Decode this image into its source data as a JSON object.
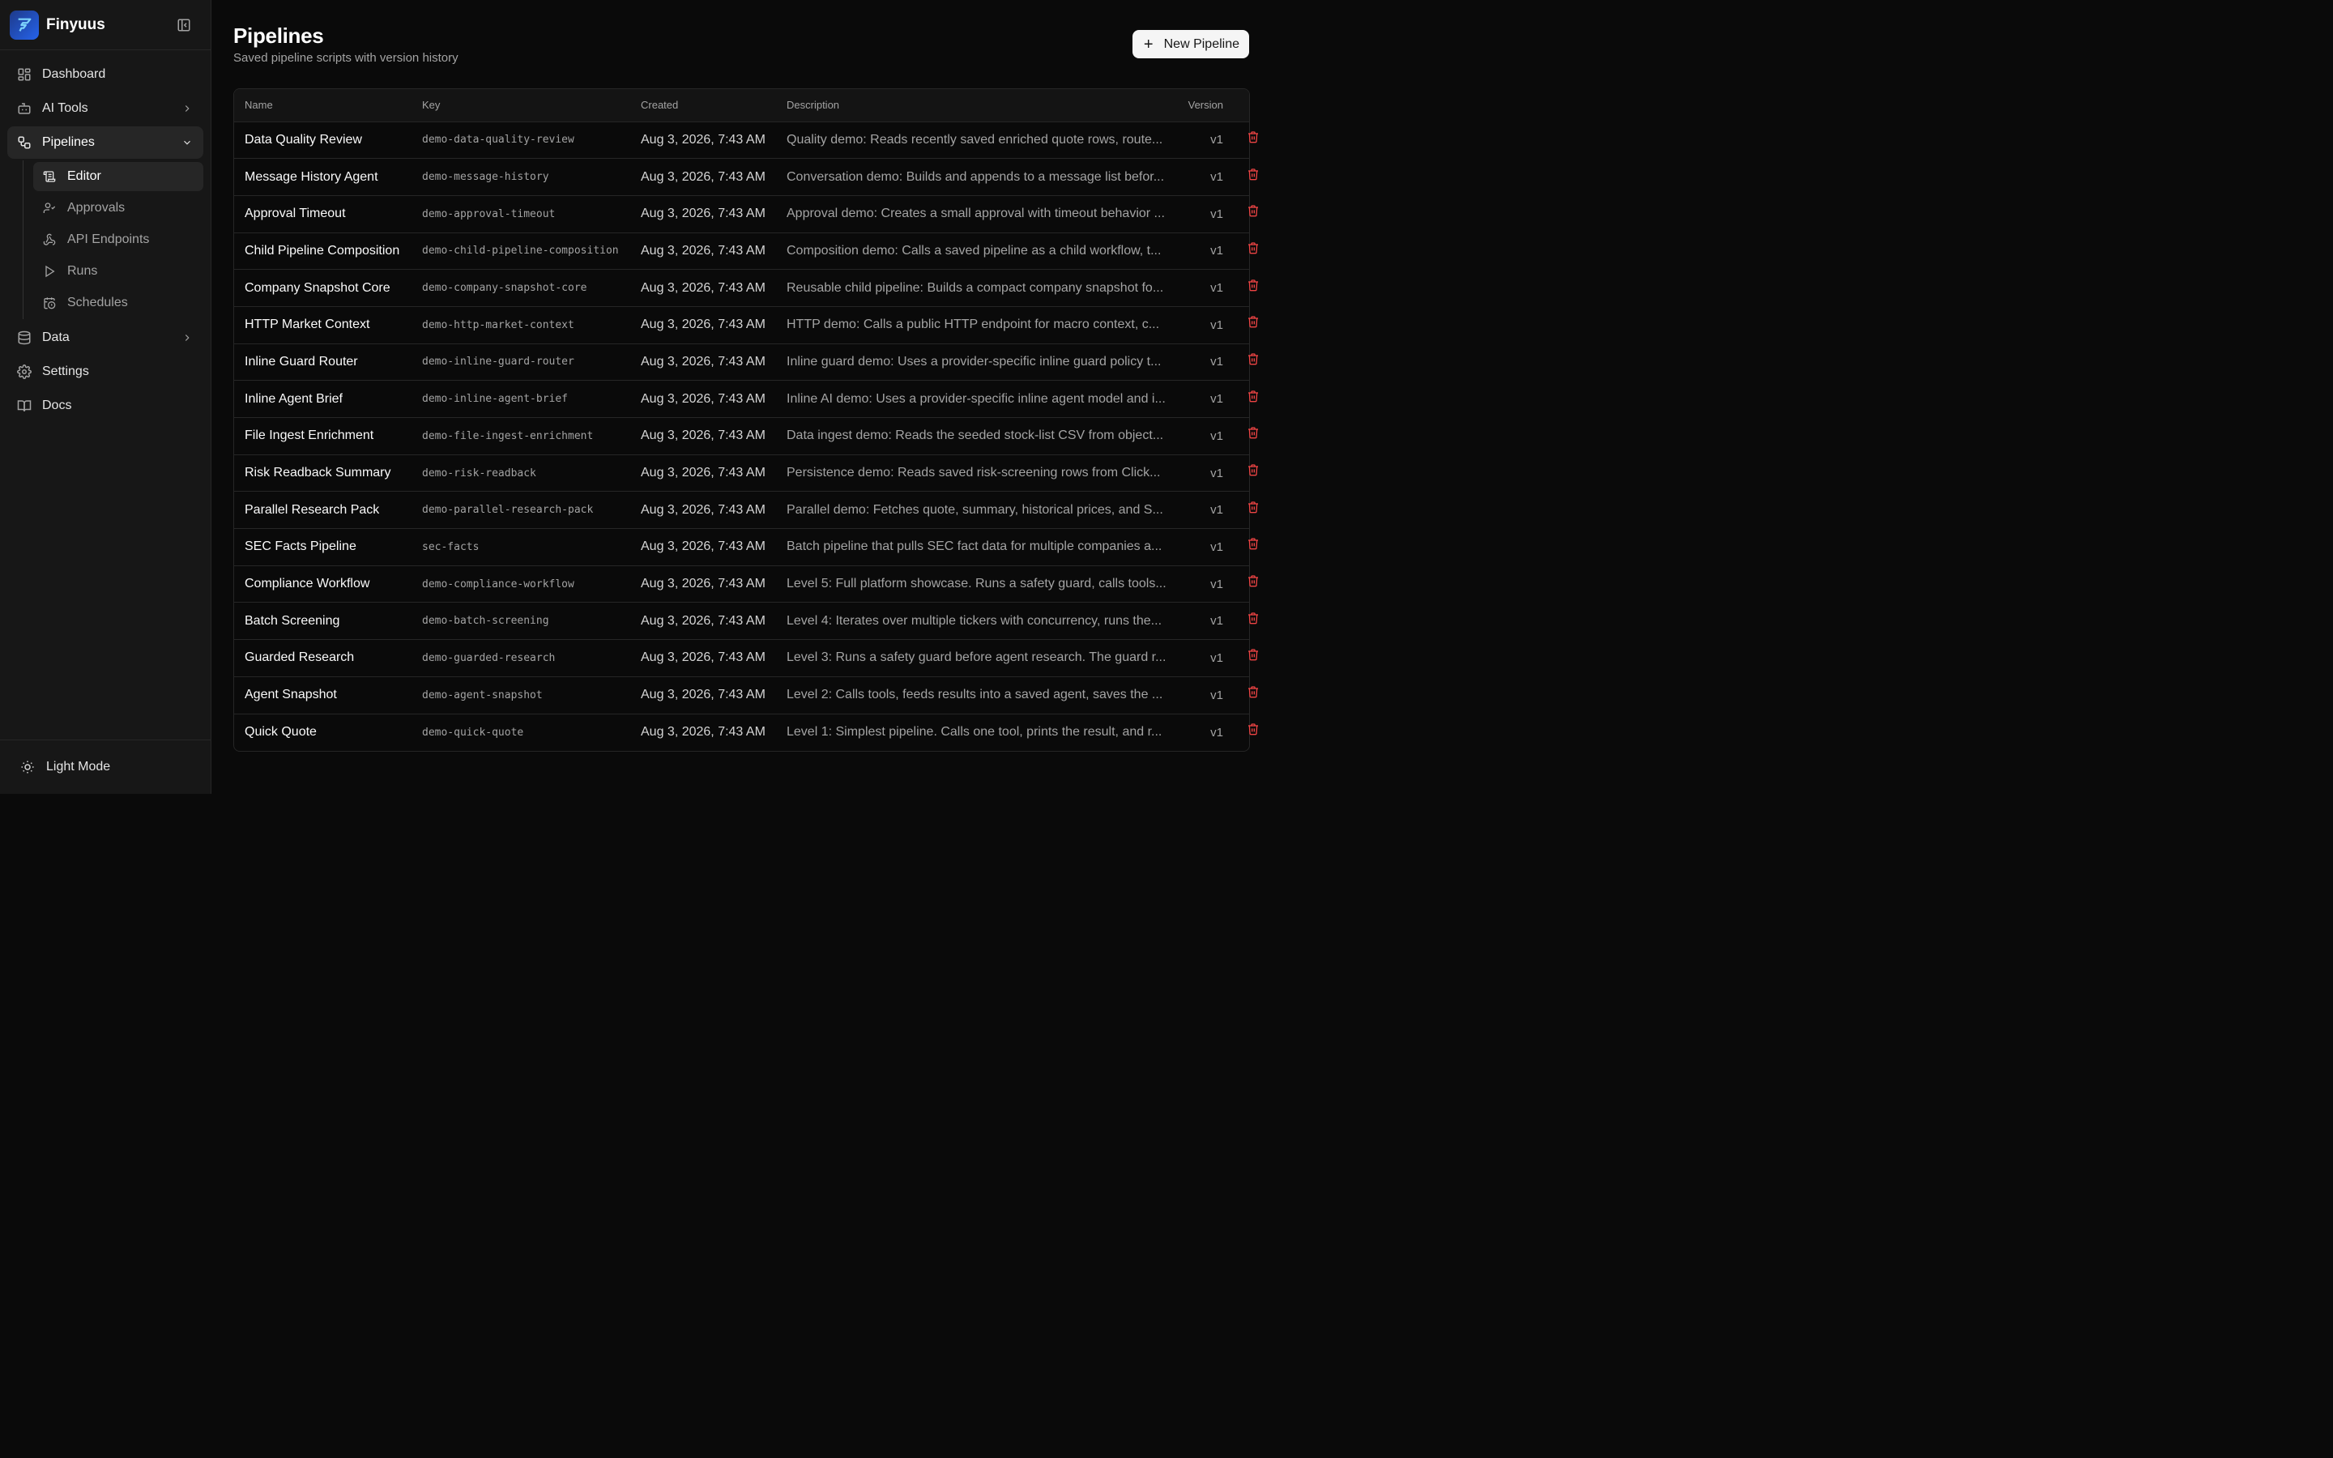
{
  "app": {
    "name": "Finyuus"
  },
  "sidebar": {
    "items": [
      {
        "label": "Dashboard"
      },
      {
        "label": "AI Tools"
      },
      {
        "label": "Pipelines"
      },
      {
        "label": "Data"
      },
      {
        "label": "Settings"
      },
      {
        "label": "Docs"
      }
    ],
    "pipelines_sub": [
      {
        "label": "Editor"
      },
      {
        "label": "Approvals"
      },
      {
        "label": "API Endpoints"
      },
      {
        "label": "Runs"
      },
      {
        "label": "Schedules"
      }
    ],
    "footer_label": "Light Mode"
  },
  "header": {
    "title": "Pipelines",
    "subtitle": "Saved pipeline scripts with version history",
    "new_button": "New Pipeline"
  },
  "table": {
    "columns": [
      "Name",
      "Key",
      "Created",
      "Description",
      "Version"
    ],
    "rows": [
      {
        "name": "Data Quality Review",
        "key": "demo-data-quality-review",
        "created": "Aug 3, 2026, 7:43 AM",
        "description": "Quality demo: Reads recently saved enriched quote rows, route...",
        "version": "v1"
      },
      {
        "name": "Message History Agent",
        "key": "demo-message-history",
        "created": "Aug 3, 2026, 7:43 AM",
        "description": "Conversation demo: Builds and appends to a message list befor...",
        "version": "v1"
      },
      {
        "name": "Approval Timeout",
        "key": "demo-approval-timeout",
        "created": "Aug 3, 2026, 7:43 AM",
        "description": "Approval demo: Creates a small approval with timeout behavior ...",
        "version": "v1"
      },
      {
        "name": "Child Pipeline Composition",
        "key": "demo-child-pipeline-composition",
        "created": "Aug 3, 2026, 7:43 AM",
        "description": "Composition demo: Calls a saved pipeline as a child workflow, t...",
        "version": "v1"
      },
      {
        "name": "Company Snapshot Core",
        "key": "demo-company-snapshot-core",
        "created": "Aug 3, 2026, 7:43 AM",
        "description": "Reusable child pipeline: Builds a compact company snapshot fo...",
        "version": "v1"
      },
      {
        "name": "HTTP Market Context",
        "key": "demo-http-market-context",
        "created": "Aug 3, 2026, 7:43 AM",
        "description": "HTTP demo: Calls a public HTTP endpoint for macro context, c...",
        "version": "v1"
      },
      {
        "name": "Inline Guard Router",
        "key": "demo-inline-guard-router",
        "created": "Aug 3, 2026, 7:43 AM",
        "description": "Inline guard demo: Uses a provider-specific inline guard policy t...",
        "version": "v1"
      },
      {
        "name": "Inline Agent Brief",
        "key": "demo-inline-agent-brief",
        "created": "Aug 3, 2026, 7:43 AM",
        "description": "Inline AI demo: Uses a provider-specific inline agent model and i...",
        "version": "v1"
      },
      {
        "name": "File Ingest Enrichment",
        "key": "demo-file-ingest-enrichment",
        "created": "Aug 3, 2026, 7:43 AM",
        "description": "Data ingest demo: Reads the seeded stock-list CSV from object...",
        "version": "v1"
      },
      {
        "name": "Risk Readback Summary",
        "key": "demo-risk-readback",
        "created": "Aug 3, 2026, 7:43 AM",
        "description": "Persistence demo: Reads saved risk-screening rows from Click...",
        "version": "v1"
      },
      {
        "name": "Parallel Research Pack",
        "key": "demo-parallel-research-pack",
        "created": "Aug 3, 2026, 7:43 AM",
        "description": "Parallel demo: Fetches quote, summary, historical prices, and S...",
        "version": "v1"
      },
      {
        "name": "SEC Facts Pipeline",
        "key": "sec-facts",
        "created": "Aug 3, 2026, 7:43 AM",
        "description": "Batch pipeline that pulls SEC fact data for multiple companies a...",
        "version": "v1"
      },
      {
        "name": "Compliance Workflow",
        "key": "demo-compliance-workflow",
        "created": "Aug 3, 2026, 7:43 AM",
        "description": "Level 5: Full platform showcase. Runs a safety guard, calls tools...",
        "version": "v1"
      },
      {
        "name": "Batch Screening",
        "key": "demo-batch-screening",
        "created": "Aug 3, 2026, 7:43 AM",
        "description": "Level 4: Iterates over multiple tickers with concurrency, runs the...",
        "version": "v1"
      },
      {
        "name": "Guarded Research",
        "key": "demo-guarded-research",
        "created": "Aug 3, 2026, 7:43 AM",
        "description": "Level 3: Runs a safety guard before agent research. The guard r...",
        "version": "v1"
      },
      {
        "name": "Agent Snapshot",
        "key": "demo-agent-snapshot",
        "created": "Aug 3, 2026, 7:43 AM",
        "description": "Level 2: Calls tools, feeds results into a saved agent, saves the ...",
        "version": "v1"
      },
      {
        "name": "Quick Quote",
        "key": "demo-quick-quote",
        "created": "Aug 3, 2026, 7:43 AM",
        "description": "Level 1: Simplest pipeline. Calls one tool, prints the result, and r...",
        "version": "v1"
      }
    ]
  },
  "colors": {
    "delete": "#ef4444",
    "background": "#0a0a0a",
    "sidebar": "#171717"
  }
}
